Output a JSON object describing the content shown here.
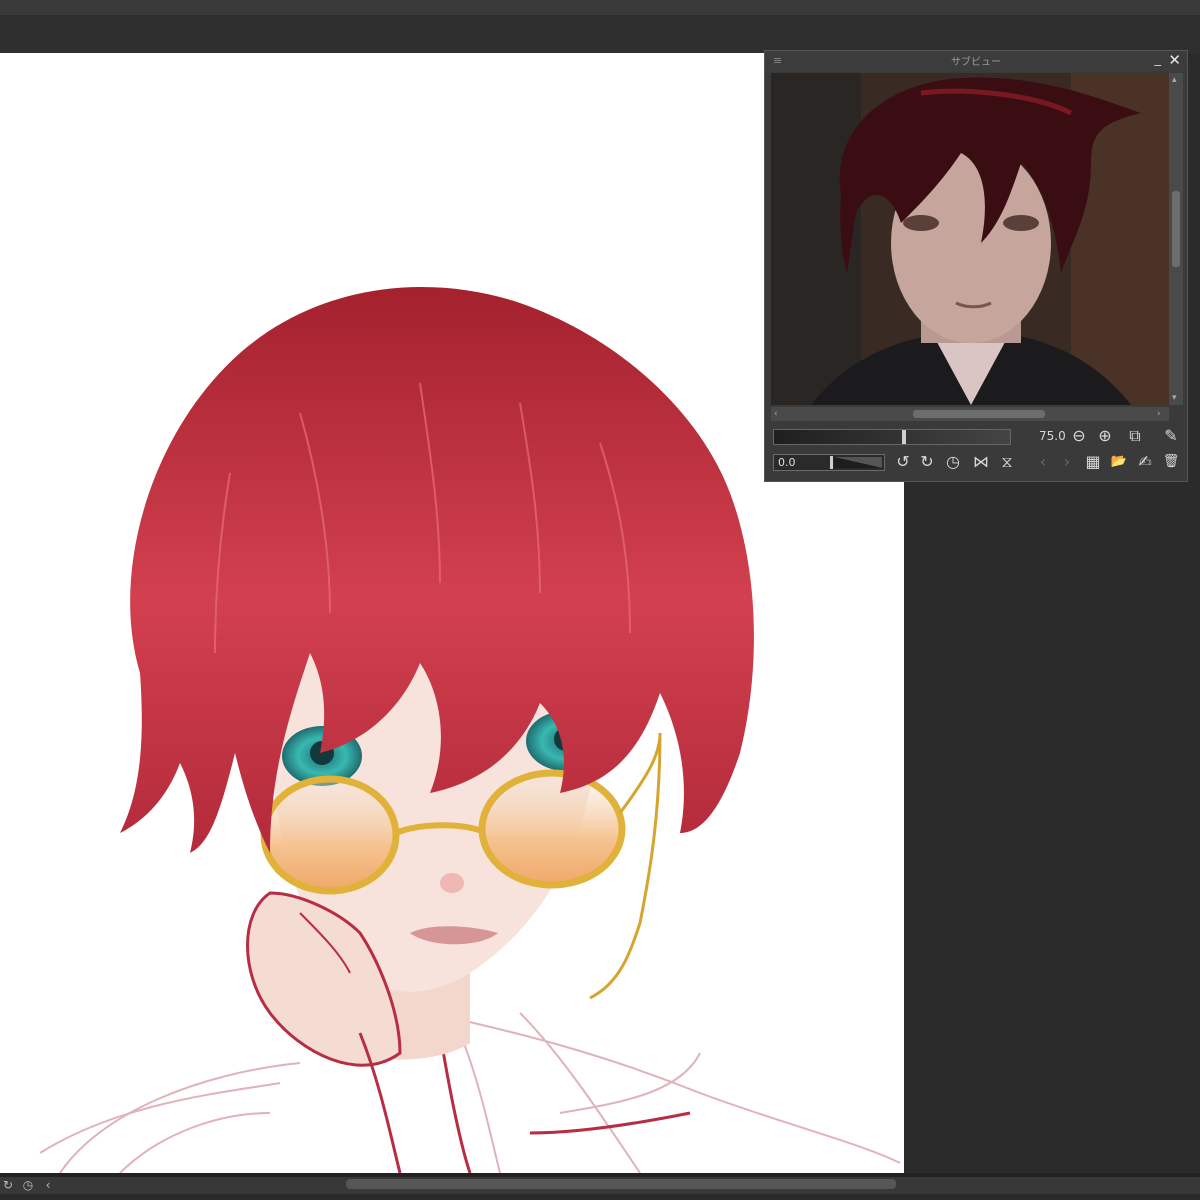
{
  "app": {
    "accent": "#2b2b2b"
  },
  "subview": {
    "title": "サブビュー",
    "menu_icon": "hamburger-icon",
    "minimize_label": "_",
    "close_label": "✕",
    "zoom_value": "75.0",
    "rotation_value": "0.0",
    "zoom_level_fraction": 0.55,
    "icons": {
      "zoom_out": "⊖",
      "zoom_in": "⊕",
      "fit": "⧉",
      "eyedropper": "✎",
      "rotate_left": "↺",
      "rotate_right": "↻",
      "reset_rotation": "◷",
      "flip_horizontal": "⋈",
      "flip_vertical": "⧖",
      "prev_image": "‹",
      "next_image": "›",
      "grid_view": "▦",
      "open_file": "📂",
      "edit": "✍",
      "delete": "🗑"
    }
  },
  "bottombar": {
    "rotate_icon": "↻",
    "reset_icon": "◷",
    "left_icon": "‹"
  }
}
